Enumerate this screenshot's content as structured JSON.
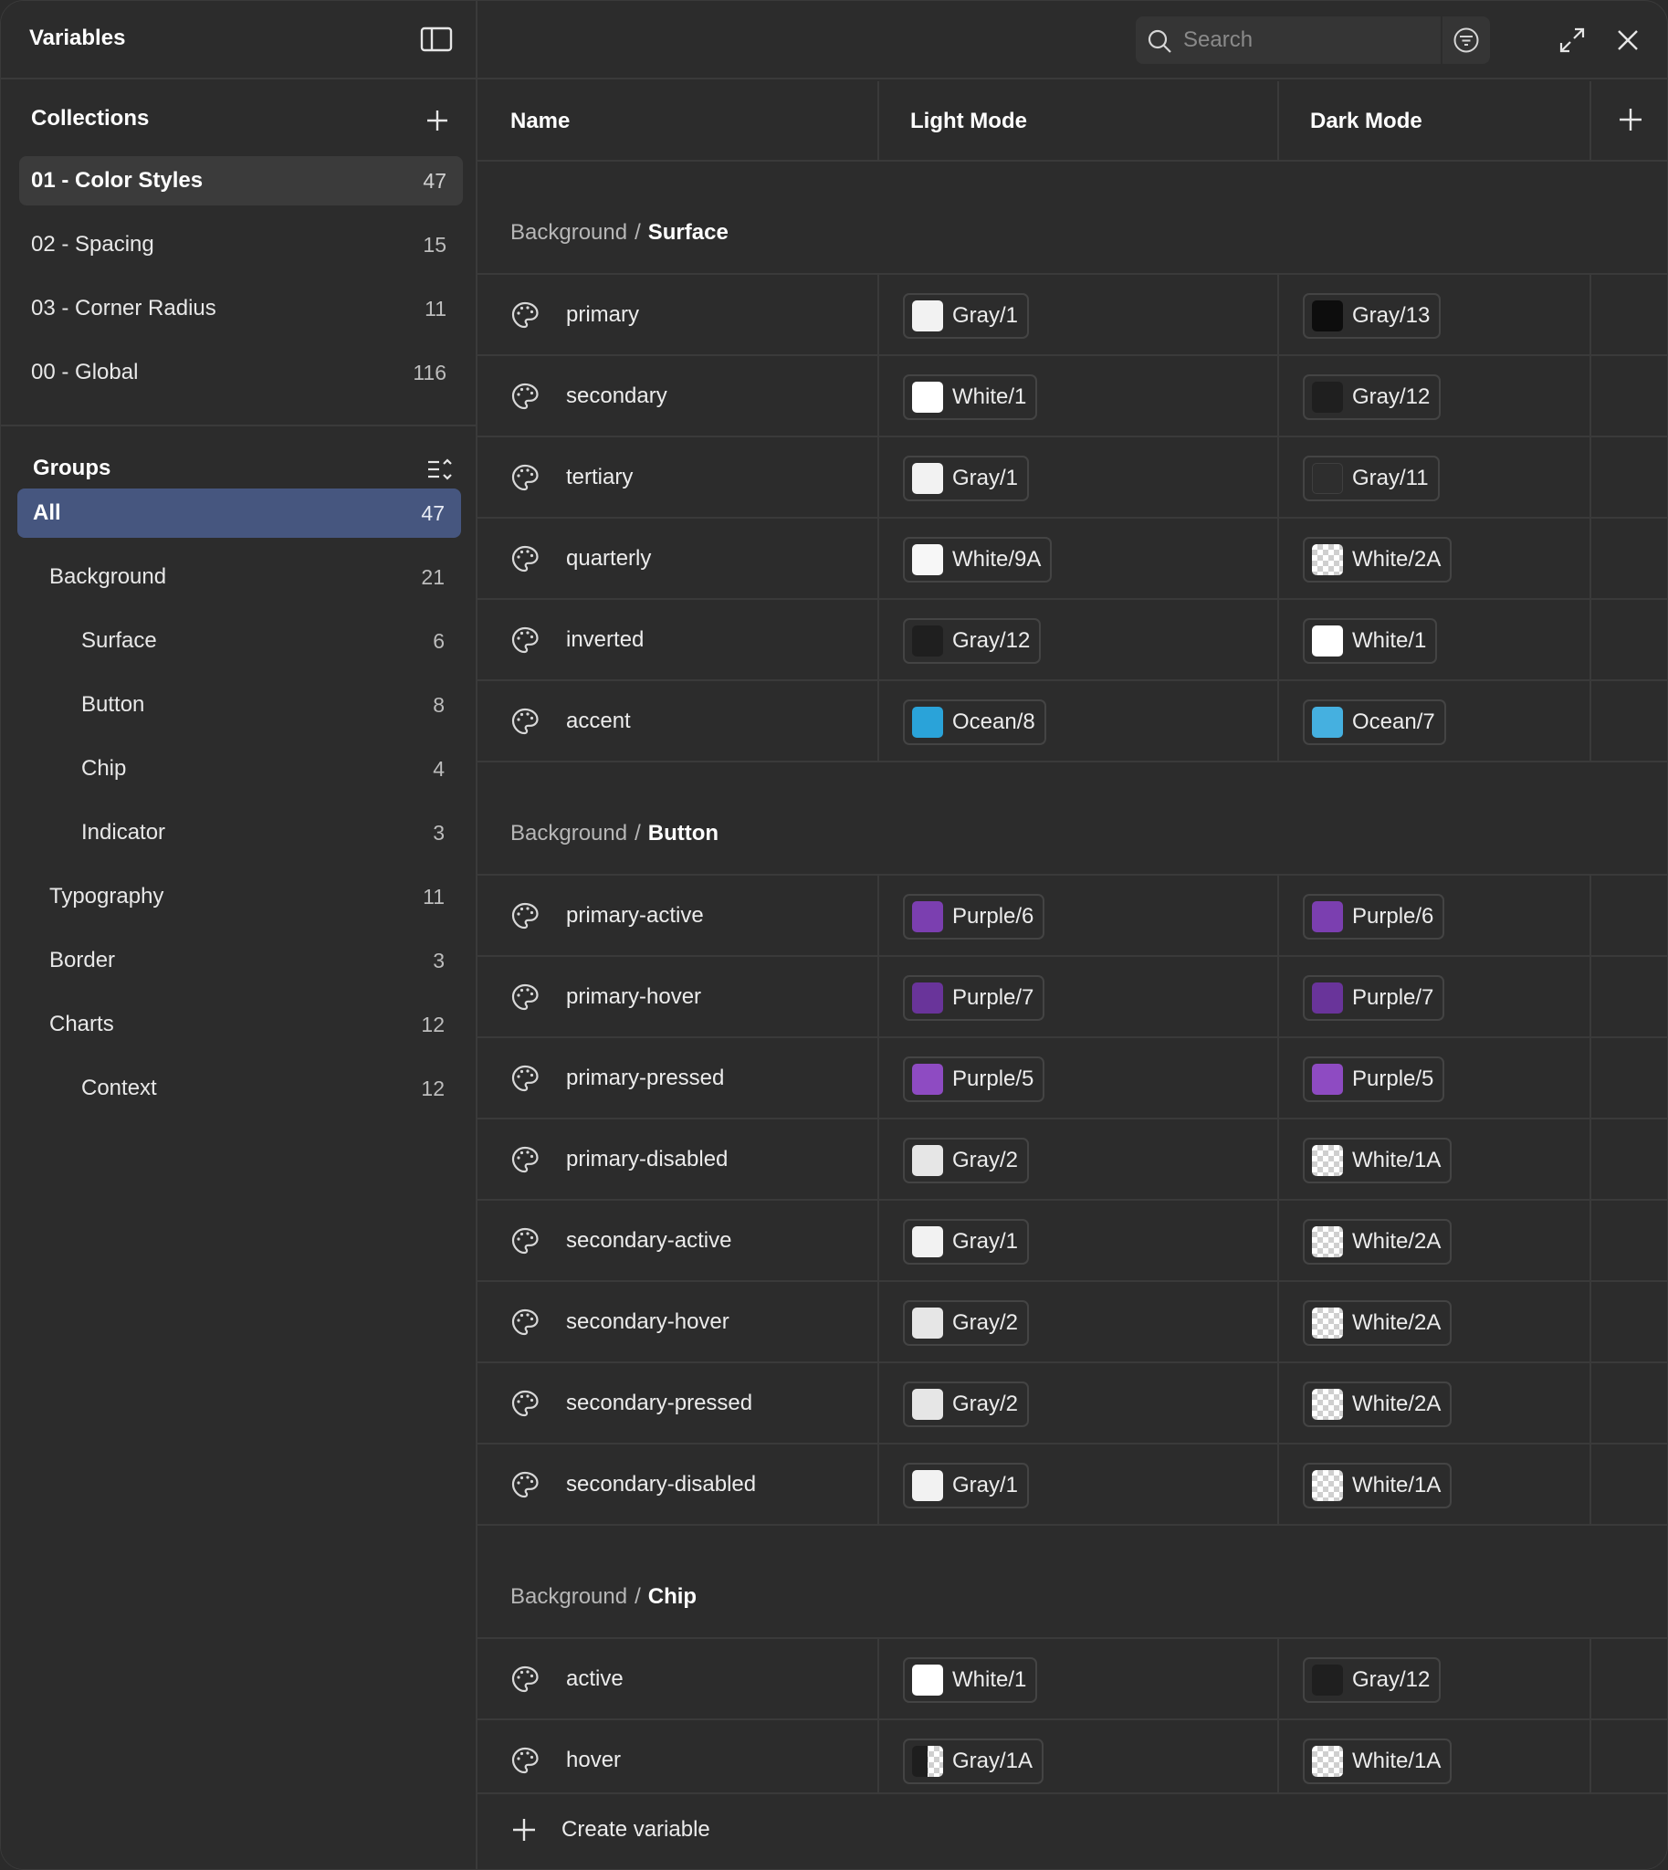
{
  "sidebar": {
    "title": "Variables",
    "collections_title": "Collections",
    "collections": [
      {
        "label": "01 - Color Styles",
        "count": "47"
      },
      {
        "label": "02 - Spacing",
        "count": "15"
      },
      {
        "label": "03 - Corner Radius",
        "count": "11"
      },
      {
        "label": "00 - Global",
        "count": "116"
      }
    ],
    "groups_title": "Groups",
    "groups": [
      {
        "label": "All",
        "count": "47"
      },
      {
        "label": "Background",
        "count": "21"
      },
      {
        "label": "Surface",
        "count": "6"
      },
      {
        "label": "Button",
        "count": "8"
      },
      {
        "label": "Chip",
        "count": "4"
      },
      {
        "label": "Indicator",
        "count": "3"
      },
      {
        "label": "Typography",
        "count": "11"
      },
      {
        "label": "Border",
        "count": "3"
      },
      {
        "label": "Charts",
        "count": "12"
      },
      {
        "label": "Context",
        "count": "12"
      }
    ]
  },
  "topbar": {
    "search_placeholder": "Search"
  },
  "columns": {
    "name": "Name",
    "light": "Light Mode",
    "dark": "Dark Mode"
  },
  "groups": [
    {
      "parent": "Background",
      "sep": "/",
      "name": "Surface",
      "rows": [
        {
          "name": "primary",
          "light": "Gray/1",
          "dark": "Gray/13"
        },
        {
          "name": "secondary",
          "light": "White/1",
          "dark": "Gray/12"
        },
        {
          "name": "tertiary",
          "light": "Gray/1",
          "dark": "Gray/11"
        },
        {
          "name": "quarterly",
          "light": "White/9A",
          "dark": "White/2A"
        },
        {
          "name": "inverted",
          "light": "Gray/12",
          "dark": "White/1"
        },
        {
          "name": "accent",
          "light": "Ocean/8",
          "dark": "Ocean/7"
        }
      ]
    },
    {
      "parent": "Background",
      "sep": "/",
      "name": "Button",
      "rows": [
        {
          "name": "primary-active",
          "light": "Purple/6",
          "dark": "Purple/6"
        },
        {
          "name": "primary-hover",
          "light": "Purple/7",
          "dark": "Purple/7"
        },
        {
          "name": "primary-pressed",
          "light": "Purple/5",
          "dark": "Purple/5"
        },
        {
          "name": "primary-disabled",
          "light": "Gray/2",
          "dark": "White/1A"
        },
        {
          "name": "secondary-active",
          "light": "Gray/1",
          "dark": "White/2A"
        },
        {
          "name": "secondary-hover",
          "light": "Gray/2",
          "dark": "White/2A"
        },
        {
          "name": "secondary-pressed",
          "light": "Gray/2",
          "dark": "White/2A"
        },
        {
          "name": "secondary-disabled",
          "light": "Gray/1",
          "dark": "White/1A"
        }
      ]
    },
    {
      "parent": "Background",
      "sep": "/",
      "name": "Chip",
      "rows": [
        {
          "name": "active",
          "light": "White/1",
          "dark": "Gray/12"
        },
        {
          "name": "hover",
          "light": "Gray/1A",
          "dark": "White/1A"
        }
      ]
    }
  ],
  "footer": {
    "create_label": "Create variable"
  },
  "swatch_colors": {
    "Gray/1": "#f2f2f2",
    "Gray/2": "#e6e6e6",
    "Gray/11": "#2e2e2e",
    "Gray/12": "#1f1f1f",
    "Gray/13": "#0d0d0d",
    "White/1": "#ffffff",
    "White/9A": "#f7f7f7",
    "Ocean/8": "#2aa3d9",
    "Ocean/7": "#45b0e0",
    "Purple/5": "#8e4bc2",
    "Purple/6": "#7b3fb0",
    "Purple/7": "#69349a"
  },
  "theme": {
    "accent_selected": "#46567f",
    "background": "#2c2c2c",
    "divider": "#3a3a3a"
  }
}
